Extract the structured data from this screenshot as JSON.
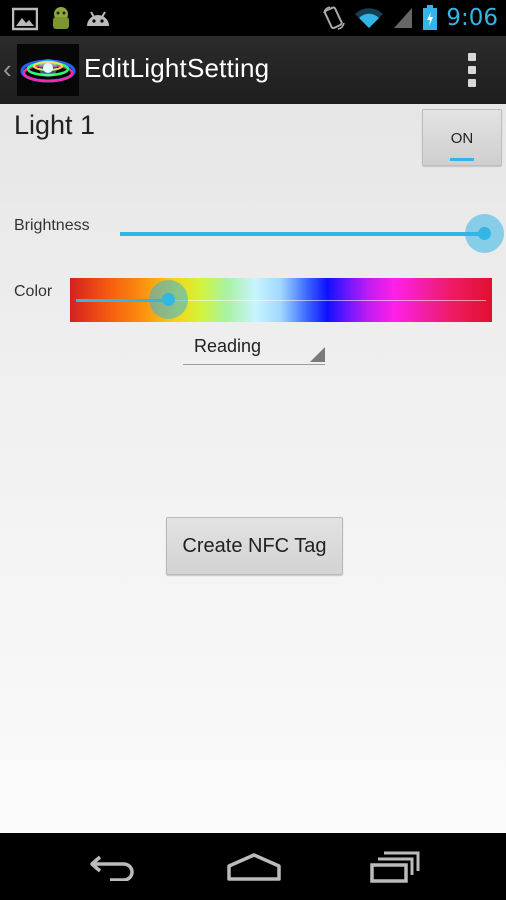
{
  "status_bar": {
    "time": "9:06",
    "icons": [
      "gallery-icon",
      "android-icon",
      "android-head-icon",
      "rotate-icon",
      "wifi-icon",
      "signal-icon",
      "battery-charging-icon"
    ]
  },
  "action_bar": {
    "title": "EditLightSetting",
    "up_icon": "chevron-left-icon",
    "menu_icon": "overflow-menu-icon"
  },
  "light": {
    "name": "Light 1",
    "toggle_label": "ON",
    "toggle_on": true
  },
  "brightness": {
    "label": "Brightness",
    "value": 1.0
  },
  "color": {
    "label": "Color",
    "value": 0.24
  },
  "mode_spinner": {
    "selected": "Reading"
  },
  "nfc_button": {
    "label": "Create NFC Tag"
  },
  "nav_bar": {
    "icons": [
      "back-icon",
      "home-icon",
      "recents-icon"
    ]
  },
  "colors": {
    "accent": "#33b5e5",
    "action_bar": "#262626",
    "background": "#f0f0f0"
  }
}
